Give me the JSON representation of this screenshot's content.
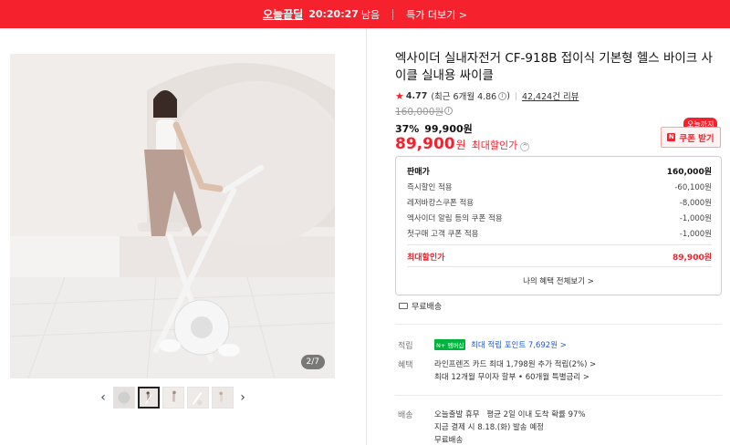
{
  "banner": {
    "brand": "오늘끝딜",
    "timer": "20:20:27",
    "timer_suffix": "남음",
    "deal_link": "특가 더보기 >"
  },
  "gallery": {
    "counter": "2/7",
    "prev_arrow": "‹",
    "next_arrow": "›",
    "thumbnail_count": 5,
    "active_thumbnail": 2
  },
  "product": {
    "title": "엑사이더 실내자전거 CF-918B 접이식 기본형 헬스 바이크 사이클 실내용 싸이클",
    "rating": "4.77",
    "rating_recent": "(최근 6개월 4.86",
    "rating_recent_close": ")",
    "review_count": "42,424건 리뷰"
  },
  "price": {
    "original": "160,000원",
    "discount_rate": "37%",
    "discounted": "99,900원",
    "final": "89,900",
    "final_unit": "원",
    "final_label": "최대할인가",
    "coupon_tag": "오늘까지",
    "coupon_badge": "N",
    "coupon_button": "쿠폰 받기"
  },
  "breakdown": {
    "rows": [
      {
        "label": "판매가",
        "value": "160,000원"
      },
      {
        "label": "즉시할인 적용",
        "value": "-60,100원"
      },
      {
        "label": "레저바캉스쿠폰 적용",
        "value": "-8,000원"
      },
      {
        "label": "엑사이더 알림 등의 쿠폰 적용",
        "value": "-1,000원"
      },
      {
        "label": "첫구매 고객 쿠폰 적용",
        "value": "-1,000원"
      }
    ],
    "max_label": "최대할인가",
    "max_value": "89,900원",
    "all_benefits": "나의 혜택 전체보기 >"
  },
  "shipping_free": "무료배송",
  "points": {
    "label": "적립",
    "badge": "N+ 멤버십",
    "text": "최대 적립 포인트 7,692원 >"
  },
  "benefits": {
    "label": "혜택",
    "line1": "라인프렌즈 카드 최대 1,798원 추가 적립(2%) >",
    "line2": "최대 12개월 무이자 할부 • 60개월 특별금리 >"
  },
  "delivery": {
    "label": "배송",
    "line1_bold": "오늘출발 휴무",
    "line1_rest": "평균 2일 이내 도착 확률 97%",
    "line2": "지금 결제 시 8.18.(화) 발송 예정",
    "line3": "무료배송"
  },
  "colors": {
    "accent": "#f5222d",
    "link": "#2458d3",
    "membership_green": "#00b33c"
  },
  "icons": [
    "star-icon",
    "info-icon",
    "chevron-up-icon",
    "chevron-left-icon",
    "chevron-right-icon",
    "truck-icon"
  ]
}
